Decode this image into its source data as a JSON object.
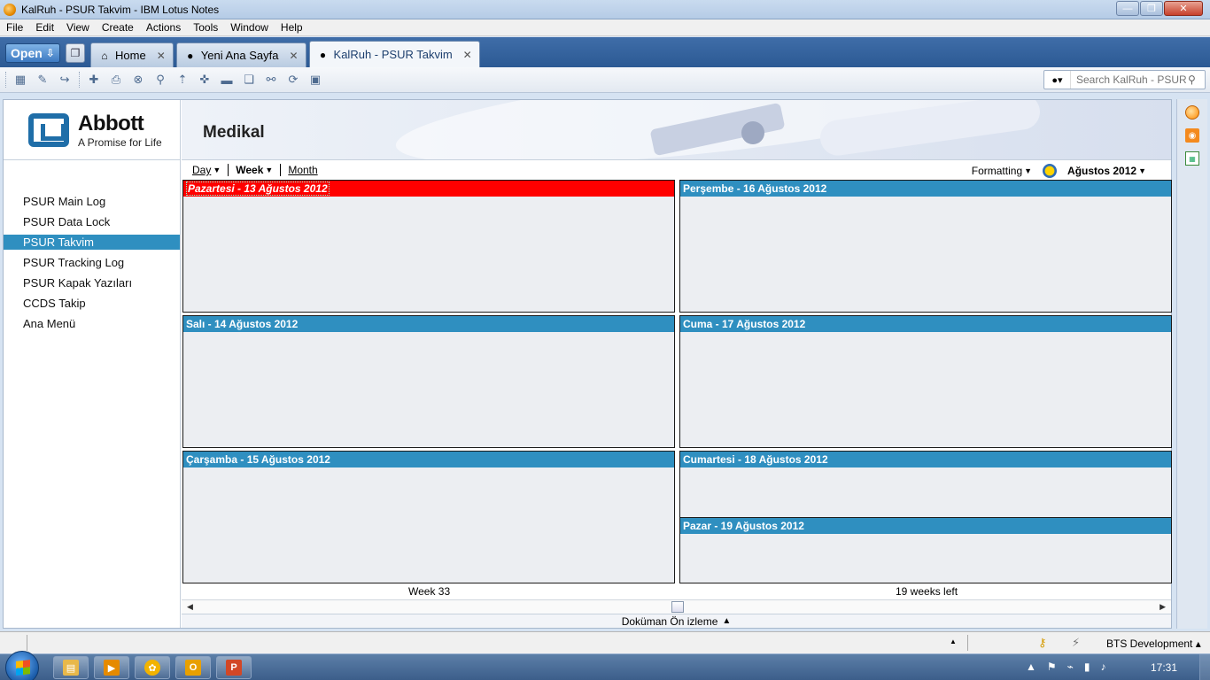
{
  "window": {
    "title": "KalRuh - PSUR Takvim - IBM Lotus Notes",
    "controls": {
      "minimize": "—",
      "maximize": "❐",
      "close": "✕"
    }
  },
  "menu": [
    "File",
    "Edit",
    "View",
    "Create",
    "Actions",
    "Tools",
    "Window",
    "Help"
  ],
  "tabbar": {
    "open_label": "Open",
    "tabs": [
      {
        "label": "Home",
        "icon": "house-icon"
      },
      {
        "label": "Yeni Ana Sayfa",
        "icon": "globe-icon"
      },
      {
        "label": "KalRuh - PSUR Takvim",
        "icon": "globe-icon",
        "active": true
      }
    ]
  },
  "search": {
    "placeholder": "Search KalRuh - PSUR"
  },
  "sidebar": {
    "brand": "Abbott",
    "tagline": "A Promise for Life",
    "items": [
      {
        "label": "PSUR Main Log"
      },
      {
        "label": "PSUR Data Lock"
      },
      {
        "label": "PSUR Takvim",
        "selected": true
      },
      {
        "label": "PSUR Tracking Log"
      },
      {
        "label": "PSUR Kapak Yazıları"
      },
      {
        "label": "CCDS Takip"
      },
      {
        "label": "Ana Menü"
      }
    ]
  },
  "content": {
    "title": "Medikal",
    "views": {
      "day": "Day",
      "week": "Week",
      "month": "Month"
    },
    "formatting": "Formatting",
    "month_label": "Ağustos 2012"
  },
  "calendar": {
    "days": [
      {
        "label": "Pazartesi - 13 Ağustos 2012",
        "today": true
      },
      {
        "label": "Salı - 14 Ağustos 2012"
      },
      {
        "label": "Çarşamba - 15 Ağustos 2012"
      },
      {
        "label": "Perşembe - 16 Ağustos 2012"
      },
      {
        "label": "Cuma - 17 Ağustos 2012"
      },
      {
        "label": "Cumartesi - 18 Ağustos 2012"
      },
      {
        "label": "Pazar - 19 Ağustos 2012"
      }
    ],
    "week_label": "Week 33",
    "weeks_left": "19 weeks left",
    "preview_label": "Doküman Ön izleme"
  },
  "statusbar": {
    "location": "BTS Development"
  },
  "taskbar": {
    "clock": "17:31"
  },
  "colors": {
    "day_header": "#2f8fc0",
    "today_header": "#ff0000",
    "selected_nav": "#2f8fc0"
  }
}
